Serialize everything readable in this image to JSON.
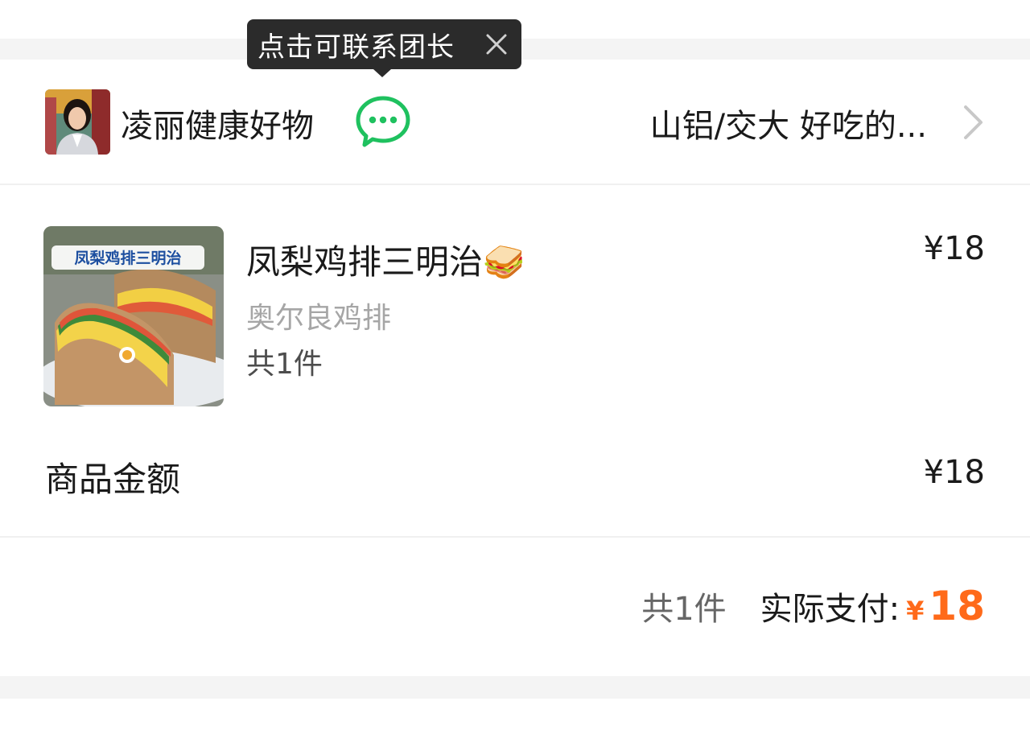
{
  "tooltip": {
    "text": "点击可联系团长",
    "close_icon": "close-icon"
  },
  "header": {
    "leader_name": "凌丽健康好物",
    "chat_icon": "wechat-chat-icon",
    "location": "山铝/交大 好吃的...",
    "chevron_icon": "chevron-right-icon"
  },
  "product": {
    "image_caption": "凤梨鸡排三明治",
    "title": "凤梨鸡排三明治🥪",
    "subtitle": "奥尔良鸡排",
    "quantity": "共1件",
    "price": "¥18"
  },
  "subtotal": {
    "label": "商品金额",
    "value": "¥18"
  },
  "summary": {
    "count": "共1件",
    "label": "实际支付:",
    "currency": "¥",
    "amount": "18"
  },
  "colors": {
    "accent": "#ff6a1a",
    "wechat_green": "#1fc15f",
    "tooltip_bg": "#2b2b2b",
    "divider": "#f4f4f4"
  }
}
